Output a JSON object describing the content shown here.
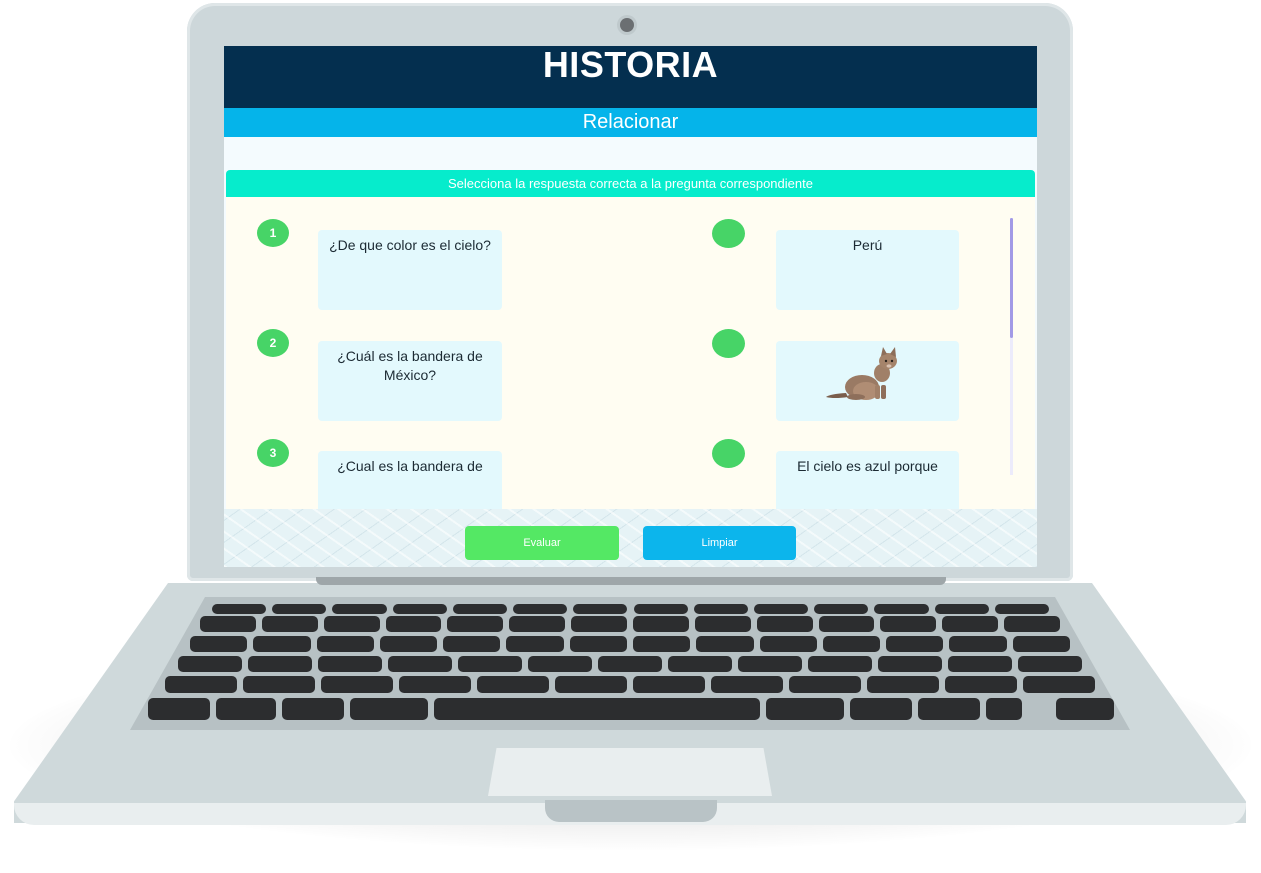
{
  "header": {
    "title": "HISTORIA",
    "subtitle": "Relacionar"
  },
  "instruction": "Selecciona la respuesta correcta a la pregunta correspondiente",
  "questions": [
    {
      "number": "1",
      "text": "¿De que color es el cielo?"
    },
    {
      "number": "2",
      "text": "¿Cuál es la bandera de México?"
    },
    {
      "number": "3",
      "text": "¿Cual es la bandera de"
    }
  ],
  "answers": [
    {
      "text": "Perú",
      "image": null
    },
    {
      "text": "",
      "image": "cat-image"
    },
    {
      "text": "El cielo es azul porque",
      "image": null
    }
  ],
  "buttons": {
    "evaluate_label": "Evaluar",
    "clear_label": "Limpiar"
  },
  "colors": {
    "header_bg": "#042f4f",
    "subheader_bg": "#05b4ea",
    "instruction_bg": "#06eccc",
    "number_badge": "#47d467",
    "card_bg": "#e3f9fd",
    "evaluate_button": "#54e864",
    "clear_button": "#0cb5ec"
  }
}
